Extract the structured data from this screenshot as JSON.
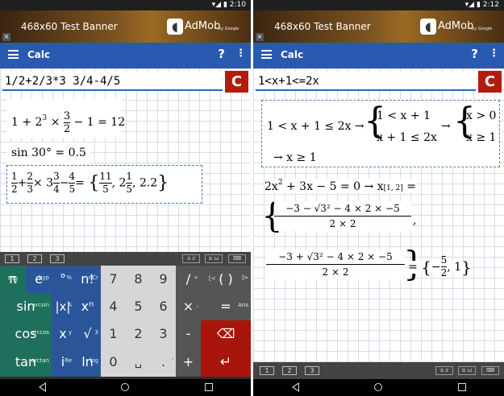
{
  "screens": [
    {
      "status": {
        "time": "2:10"
      },
      "banner": {
        "text": "468x60  Test Banner",
        "admob": "AdMob",
        "admob_sub": "by Google"
      },
      "appbar": {
        "title": "Calc",
        "help": "?",
        "more": "⋮"
      },
      "input": {
        "value": "1/2+2/3*3 3/4-4/5"
      },
      "clear_label": "C",
      "results": {
        "r1": "= 12",
        "r2": "sin 30° = 0.5"
      },
      "keyboard": {
        "tabs": [
          "1",
          "2",
          "3"
        ],
        "right_tabs": [
          "a z",
          "α ω",
          "⌨"
        ],
        "keys": {
          "pi": "π",
          "e": "e",
          "deg": "°",
          "fact": "n!",
          "sin": "sin",
          "abs": "|x|",
          "pow": "xⁿ",
          "cos": "cos",
          "x": "x",
          "sqrt": "√",
          "tan": "tan",
          "i": "i",
          "ln": "ln",
          "d7": "7",
          "d8": "8",
          "d9": "9",
          "div": "/",
          "paren": "( )",
          "d4": "4",
          "d5": "5",
          "d6": "6",
          "mul": "×",
          "eq": "=",
          "d1": "1",
          "d2": "2",
          "d3": "3",
          "minus": "-",
          "del": "⌫",
          "d0": "0",
          "space": "␣",
          "dot": ".",
          "plus": "+",
          "enter": "↵"
        },
        "sup": {
          "trig": "trig",
          "hyp": "hyp",
          "pct": "%",
          "ncr": "nCr",
          "arcsin": "arcsin",
          "A": "A",
          "arccos": "arccos",
          "y": "y",
          "three": "3",
          "arctan": "arctan",
          "Re": "Re",
          "log": "log",
          "Ans": "Ans",
          "div_sym": "÷",
          "lbr": "[<",
          "rbr": "]>",
          "comma": ",",
          "apos": "'"
        }
      }
    },
    {
      "status": {
        "time": "2:12"
      },
      "banner": {
        "text": "468x60  Test Banner",
        "admob": "AdMob",
        "admob_sub": "by Google"
      },
      "appbar": {
        "title": "Calc",
        "help": "?",
        "more": "⋮"
      },
      "input": {
        "value": "1<x+1<=2x"
      },
      "clear_label": "C",
      "results": {
        "s1": "1 < x + 1 ≤ 2x →",
        "s1a": "1 < x + 1",
        "s1b": "x + 1 ≤ 2x",
        "s1c": "x > 0",
        "s1d": "x ≥ 1",
        "s1e": "→ x ≥ 1",
        "s2": "+ 3x − 5 = 0 → x",
        "s2sub": "[1, 2]",
        "s2c": "−3 − √3² − 4 × 2 × −5",
        "s2d": "2 × 2",
        "s2e": "−3 + √3² − 4 × 2 × −5",
        "s2f": "2 × 2",
        "s2g": "5",
        "s2h": "2"
      },
      "keyboard": {
        "tabs": [
          "1",
          "2",
          "3"
        ],
        "right_tabs": [
          "a z",
          "α ω",
          "⌨"
        ]
      }
    }
  ]
}
